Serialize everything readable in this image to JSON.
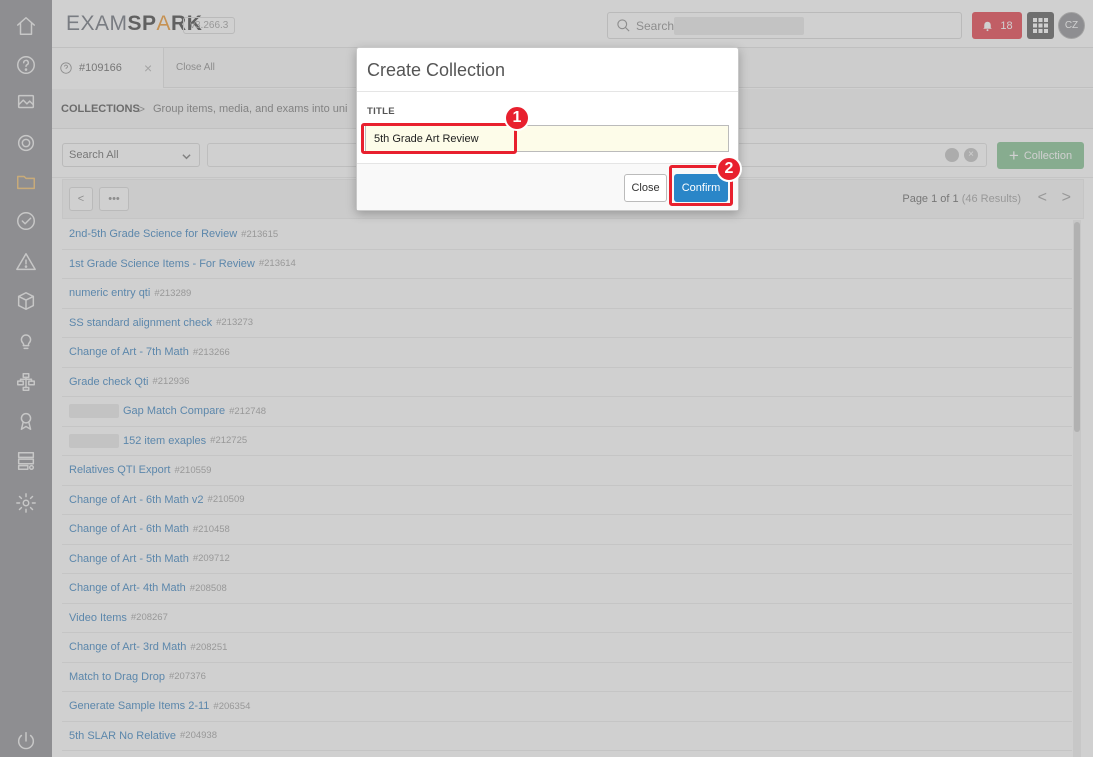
{
  "app": {
    "logo_light": "EXAM",
    "logo_bold_1": "SP",
    "logo_flame": "A",
    "logo_bold_2": "RK",
    "version": "v3.266.3"
  },
  "topbar": {
    "search_placeholder": "Search",
    "notification_count": "18",
    "avatar_initials": "CZ"
  },
  "tabs": {
    "items": [
      {
        "label": "#109166",
        "close": "×"
      }
    ],
    "close_all": "Close All"
  },
  "breadcrumb": {
    "root": "COLLECTIONS",
    "separator": ">",
    "description": "Group items, media, and exams into uni"
  },
  "filter": {
    "scope_label": "Search All",
    "clear_glyph": "×",
    "add_button": "Collection",
    "add_glyph": "+"
  },
  "list_header": {
    "back_glyph": "<",
    "more_glyph": "•••",
    "page_text": "Page 1 of 1",
    "results_text": " (46 Results)",
    "prev_glyph": "<",
    "next_glyph": ">"
  },
  "collections": [
    {
      "name": "2nd-5th Grade Science for Review",
      "id": "#213615"
    },
    {
      "name": "1st Grade Science Items - For Review",
      "id": "#213614"
    },
    {
      "name": "numeric entry qti",
      "id": "#213289"
    },
    {
      "name": "SS standard alignment check",
      "id": "#213273"
    },
    {
      "name": "Change of Art - 7th Math",
      "id": "#213266"
    },
    {
      "name": "Grade check Qti",
      "id": "#212936"
    },
    {
      "name": "Gap Match Compare",
      "id": "#212748"
    },
    {
      "name": "152 item exaples",
      "id": "#212725"
    },
    {
      "name": "Relatives QTI Export",
      "id": "#210559"
    },
    {
      "name": "Change of Art - 6th Math v2",
      "id": "#210509"
    },
    {
      "name": "Change of Art - 6th Math",
      "id": "#210458"
    },
    {
      "name": "Change of Art - 5th Math",
      "id": "#209712"
    },
    {
      "name": "Change of Art- 4th Math",
      "id": "#208508"
    },
    {
      "name": "Video Items",
      "id": "#208267"
    },
    {
      "name": "Change of Art- 3rd Math",
      "id": "#208251"
    },
    {
      "name": "Match to Drag Drop",
      "id": "#207376"
    },
    {
      "name": "Generate Sample Items 2-11",
      "id": "#206354"
    },
    {
      "name": "5th SLAR No Relative",
      "id": "#204938"
    }
  ],
  "modal": {
    "title": "Create Collection",
    "field_label": "TITLE",
    "field_value": "5th Grade Art Review",
    "close_label": "Close",
    "confirm_label": "Confirm"
  },
  "annotations": {
    "badge_1": "1",
    "badge_2": "2"
  },
  "colors": {
    "accent": "#2a86c8",
    "highlight": "#e8202e",
    "notification": "#e8505b",
    "add_button": "#8fc89b",
    "link": "#4d8fc7"
  }
}
